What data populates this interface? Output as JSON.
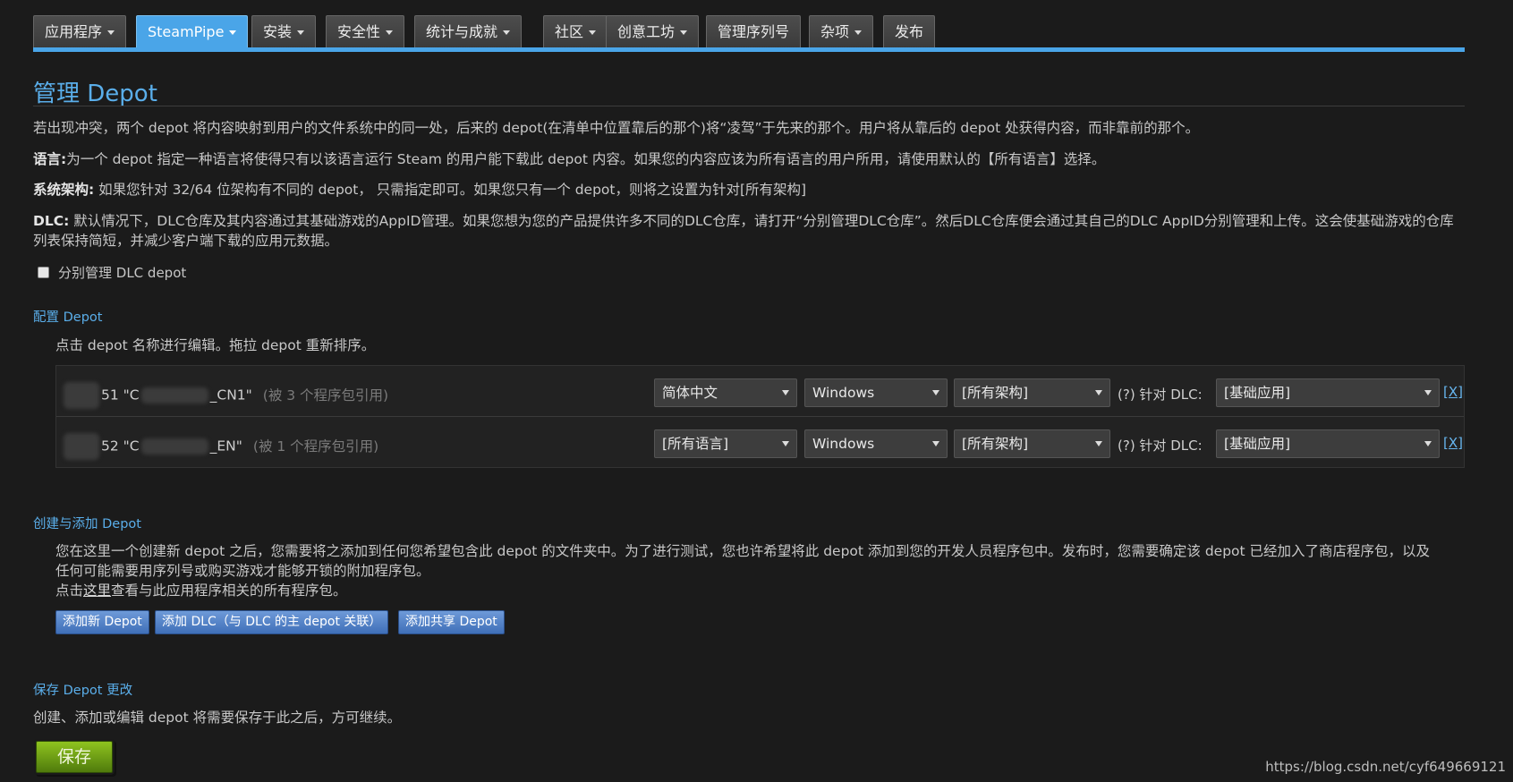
{
  "nav": {
    "tabs": [
      {
        "label": "应用程序",
        "dropdown": true
      },
      {
        "label": "SteamPipe",
        "dropdown": true,
        "active": true
      },
      {
        "label": "安装",
        "dropdown": true
      },
      {
        "label": "安全性",
        "dropdown": true
      },
      {
        "label": "统计与成就",
        "dropdown": true
      },
      {
        "label": "社区",
        "dropdown": true
      },
      {
        "label": "创意工坊",
        "dropdown": true
      },
      {
        "label": "管理序列号",
        "dropdown": false
      },
      {
        "label": "杂项",
        "dropdown": true
      },
      {
        "label": "发布",
        "dropdown": false
      }
    ]
  },
  "page": {
    "title": "管理 Depot",
    "intro": "若出现冲突，两个 depot 将内容映射到用户的文件系统中的同一处，后来的 depot(在清单中位置靠后的那个)将“凌驾”于先来的那个。用户将从靠后的 depot 处获得内容，而非靠前的那个。",
    "language_label": "语言:",
    "language_text": "为一个 depot 指定一种语言将使得只有以该语言运行 Steam 的用户能下载此 depot 内容。如果您的内容应该为所有语言的用户所用，请使用默认的【所有语言】选择。",
    "arch_label": "系统架构:",
    "arch_text": "如果您针对 32/64 位架构有不同的 depot， 只需指定即可。如果您只有一个 depot，则将之设置为针对[所有架构]",
    "dlc_label": "DLC:",
    "dlc_text": "默认情况下，DLC仓库及其内容通过其基础游戏的AppID管理。如果您想为您的产品提供许多不同的DLC仓库，请打开“分别管理DLC仓库”。然后DLC仓库便会通过其自己的DLC AppID分别管理和上传。这会使基础游戏的仓库列表保持简短，并减少客户端下载的应用元数据。",
    "dlc_checkbox_label": "分别管理 DLC depot"
  },
  "configure": {
    "heading": "配置 Depot",
    "hint": "点击 depot 名称进行编辑。拖拉 depot 重新排序。",
    "rows": [
      {
        "id_suffix": "51",
        "name_prefix": "\"C",
        "name_suffix": "_CN1\"",
        "packages": "(被 3 个程序包引用)",
        "language": "简体中文",
        "os": "Windows",
        "arch": "[所有架构]",
        "dlc_label": "(?) 针对 DLC:",
        "dlc": "[基础应用]",
        "remove": "[X]"
      },
      {
        "id_suffix": "52",
        "name_prefix": "\"C",
        "name_suffix": "_EN\"",
        "packages": "(被 1 个程序包引用)",
        "language": "[所有语言]",
        "os": "Windows",
        "arch": "[所有架构]",
        "dlc_label": "(?) 针对 DLC:",
        "dlc": "[基础应用]",
        "remove": "[X]"
      }
    ]
  },
  "create": {
    "heading": "创建与添加 Depot",
    "text": "您在这里一个创建新 depot 之后，您需要将之添加到任何您希望包含此 depot 的文件夹中。为了进行测试，您也许希望将此 depot 添加到您的开发人员程序包中。发布时，您需要确定该 depot 已经加入了商店程序包，以及任何可能需要用序列号或购买游戏才能够开锁的附加程序包。",
    "link_prefix": "点击",
    "link_text": "这里",
    "link_suffix": "查看与此应用程序相关的所有程序包。",
    "buttons": [
      "添加新 Depot",
      "添加 DLC（与 DLC 的主 depot 关联）",
      "添加共享 Depot"
    ]
  },
  "save": {
    "heading": "保存 Depot 更改",
    "text": "创建、添加或编辑 depot 将需要保存于此之后，方可继续。",
    "button": "保存"
  },
  "watermark": "https://blog.csdn.net/cyf649669121",
  "colors": {
    "accent": "#4aa5e8",
    "link": "#5aaeea",
    "save_green": "#8fc31f",
    "button_blue": "#4f7fc4"
  }
}
